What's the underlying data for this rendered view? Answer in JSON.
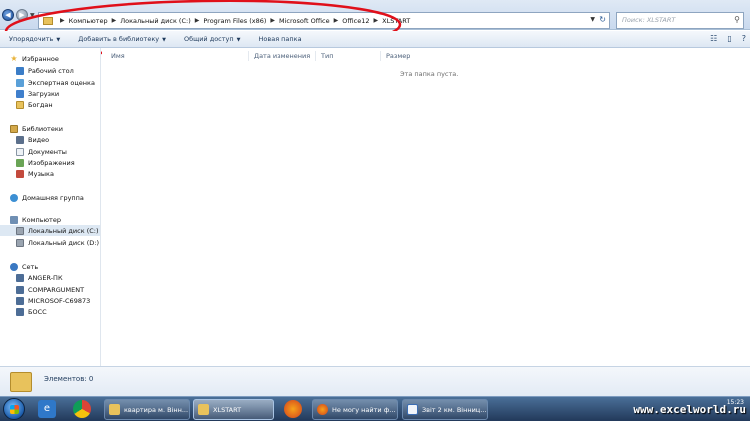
{
  "address_bar": {
    "crumbs": [
      "Компьютер",
      "Локальный диск (C:)",
      "Program Files (x86)",
      "Microsoft Office",
      "Office12",
      "XLSTART"
    ],
    "search_placeholder": "Поиск: XLSTART"
  },
  "toolbar": {
    "organize": "Упорядочить",
    "add_to_library": "Добавить в библиотеку",
    "share": "Общий доступ",
    "new_folder": "Новая папка"
  },
  "sidebar": {
    "favorites": {
      "header": "Избранное",
      "items": [
        "Рабочий стол",
        "Экспертная оценка",
        "Загрузки",
        "Богдан"
      ]
    },
    "libraries": {
      "header": "Библиотеки",
      "items": [
        "Видео",
        "Документы",
        "Изображения",
        "Музыка"
      ]
    },
    "homegroup": "Домашняя группа",
    "computer": {
      "header": "Компьютер",
      "items": [
        "Локальный диск (C:)",
        "Локальный диск (D:)"
      ]
    },
    "network": {
      "header": "Сеть",
      "items": [
        "ANGER-ПК",
        "COMPARGUMENT",
        "MICROSOF-C69873",
        "БОСС"
      ]
    }
  },
  "main": {
    "columns": [
      "Имя",
      "Дата изменения",
      "Тип",
      "Размер"
    ],
    "empty_message": "Эта папка пуста."
  },
  "details": {
    "items_count": "Элементов: 0"
  },
  "taskbar": {
    "tasks": [
      "квартира м. Вінн...",
      "XLSTART",
      "Не могу найти ф...",
      "Звіт 2 км. Вінниц..."
    ],
    "time": "15:23",
    "watermark": "www.excelworld.ru"
  },
  "colors": {
    "annotation": "#e0101a",
    "accent": "#1e395b"
  }
}
